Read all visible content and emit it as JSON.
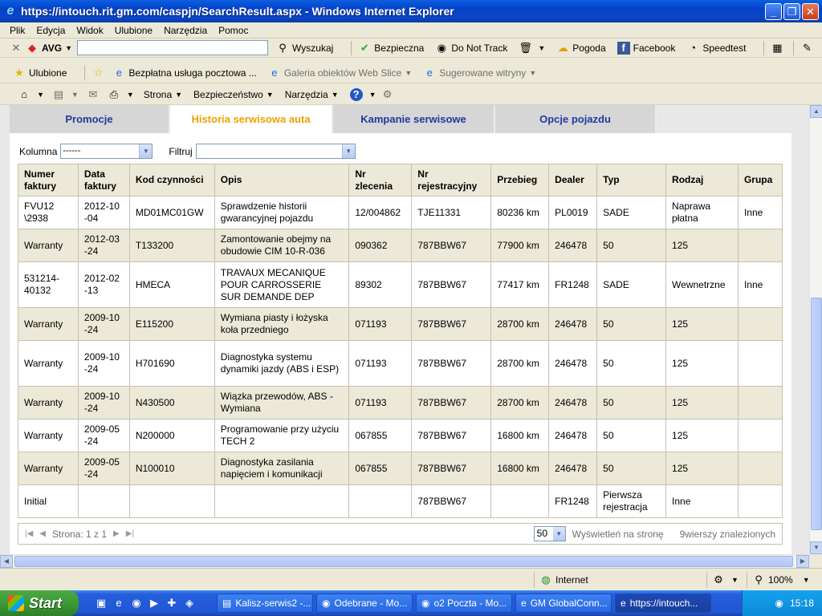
{
  "window": {
    "title": "https://intouch.rit.gm.com/caspjn/SearchResult.aspx - Windows Internet Explorer"
  },
  "menu": [
    "Plik",
    "Edycja",
    "Widok",
    "Ulubione",
    "Narzędzia",
    "Pomoc"
  ],
  "avg_toolbar": {
    "brand": "AVG",
    "search_label": "Wyszukaj",
    "safe_label": "Bezpieczna",
    "dnt_label": "Do Not Track",
    "weather_label": "Pogoda",
    "facebook_label": "Facebook",
    "speedtest_label": "Speedtest"
  },
  "favorites_bar": {
    "favorites_label": "Ulubione",
    "item1": "Bezpłatna usługa pocztowa ...",
    "item2": "Galeria obiektów Web Slice",
    "item3": "Sugerowane witryny"
  },
  "command_bar": {
    "page_label": "Strona",
    "security_label": "Bezpieczeństwo",
    "tools_label": "Narzędzia"
  },
  "tabs": [
    "Promocje",
    "Historia serwisowa auta",
    "Kampanie serwisowe",
    "Opcje pojazdu"
  ],
  "filters": {
    "column_label": "Kolumna",
    "column_value": "------",
    "filter_label": "Filtruj",
    "filter_value": ""
  },
  "table": {
    "headers": [
      "Numer faktury",
      "Data faktury",
      "Kod czynności",
      "Opis",
      "Nr zlecenia",
      "Nr rejestracyjny",
      "Przebieg",
      "Dealer",
      "Typ",
      "Rodzaj",
      "Grupa"
    ],
    "rows": [
      [
        "FVU12 \\2938",
        "2012-10 -04",
        "MD01MC01GW",
        "Sprawdzenie historii gwarancyjnej pojazdu",
        "12/004862",
        "TJE11331",
        "80236 km",
        "PL0019",
        "SADE",
        "Naprawa płatna",
        "Inne"
      ],
      [
        "Warranty",
        "2012-03 -24",
        "T133200",
        "Zamontowanie obejmy na obudowie CIM 10-R-036",
        "090362",
        "787BBW67",
        "77900 km",
        "246478",
        "50",
        "125",
        ""
      ],
      [
        "531214- 40132",
        "2012-02 -13",
        "HMECA",
        "TRAVAUX MECANIQUE POUR CARROSSERIE SUR DEMANDE DEP",
        "89302",
        "787BBW67",
        "77417 km",
        "FR1248",
        "SADE",
        "Wewnetrzne",
        "Inne"
      ],
      [
        "Warranty",
        "2009-10 -24",
        "E115200",
        "Wymiana piasty i łożyska koła przedniego",
        "071193",
        "787BBW67",
        "28700 km",
        "246478",
        "50",
        "125",
        ""
      ],
      [
        "Warranty",
        "2009-10 -24",
        "H701690",
        "Diagnostyka systemu dynamiki jazdy (ABS i ESP)",
        "071193",
        "787BBW67",
        "28700 km",
        "246478",
        "50",
        "125",
        ""
      ],
      [
        "Warranty",
        "2009-10 -24",
        "N430500",
        "Wiązka przewodów, ABS - Wymiana",
        "071193",
        "787BBW67",
        "28700 km",
        "246478",
        "50",
        "125",
        ""
      ],
      [
        "Warranty",
        "2009-05 -24",
        "N200000",
        "Programowanie przy użyciu TECH 2",
        "067855",
        "787BBW67",
        "16800 km",
        "246478",
        "50",
        "125",
        ""
      ],
      [
        "Warranty",
        "2009-05 -24",
        "N100010",
        "Diagnostyka zasilania napięciem i komunikacji",
        "067855",
        "787BBW67",
        "16800 km",
        "246478",
        "50",
        "125",
        ""
      ],
      [
        "Initial",
        "",
        "",
        "",
        "",
        "787BBW67",
        "",
        "FR1248",
        "Pierwsza rejestracja",
        "Inne",
        ""
      ]
    ]
  },
  "pager": {
    "page_text": "Strona: 1 z 1",
    "page_size": "50",
    "per_page_label": "Wyświetleń na stronę",
    "found_text": "9wierszy znalezionych"
  },
  "status": {
    "zone": "Internet",
    "zoom": "100%"
  },
  "taskbar": {
    "start_label": "Start",
    "tasks": [
      "Kalisz-serwis2 -...",
      "Odebrane - Mo...",
      "o2 Poczta - Mo...",
      "GM GlobalConn...",
      "https://intouch..."
    ],
    "clock": "15:18"
  }
}
